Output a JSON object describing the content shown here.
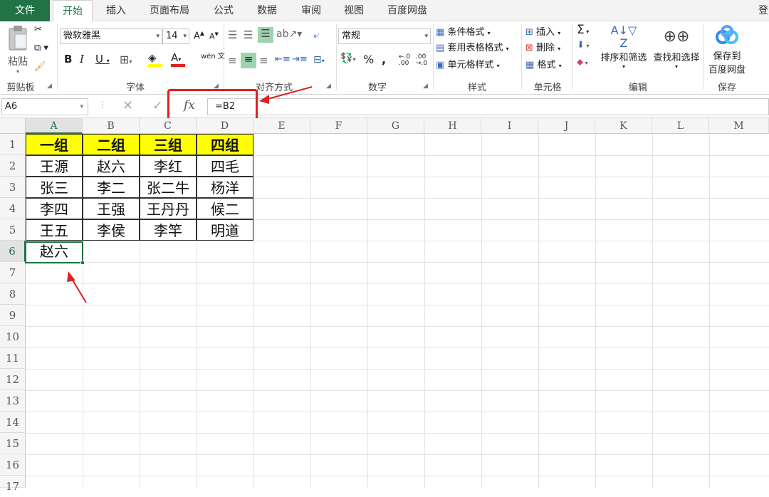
{
  "tabs": [
    "文件",
    "开始",
    "插入",
    "页面布局",
    "公式",
    "数据",
    "审阅",
    "视图",
    "百度网盘"
  ],
  "tabs_right_text": "登",
  "clipboard": {
    "paste": "粘贴",
    "label": "剪贴板"
  },
  "font": {
    "name": "微软雅黑",
    "size": "14",
    "label": "字体",
    "bold": "B",
    "italic": "I",
    "underline": "U",
    "grow": "A",
    "shrink": "A",
    "color_a": "A",
    "phonetic": "wén 文"
  },
  "alignment": {
    "label": "对齐方式"
  },
  "number": {
    "format": "常规",
    "label": "数字",
    "percent": "%",
    "comma": ","
  },
  "styles": {
    "cond": "条件格式",
    "table": "套用表格格式",
    "cell": "单元格样式",
    "label": "样式"
  },
  "cells": {
    "insert": "插入",
    "delete": "删除",
    "format": "格式",
    "label": "单元格"
  },
  "editing": {
    "sigma": "Σ",
    "sort": "排序和筛选",
    "find": "查找和选择",
    "label": "编辑"
  },
  "save": {
    "line1": "保存到",
    "line2": "百度网盘",
    "label": "保存"
  },
  "formula_bar": {
    "namebox": "A6",
    "fx": "fx",
    "formula": "=B2"
  },
  "columns": [
    "A",
    "B",
    "C",
    "D",
    "E",
    "F",
    "G",
    "H",
    "I",
    "J",
    "K",
    "L",
    "M"
  ],
  "rows": [
    "1",
    "2",
    "3",
    "4",
    "5",
    "6",
    "7",
    "8",
    "9",
    "10",
    "11",
    "12",
    "13",
    "14",
    "15",
    "16",
    "17"
  ],
  "sheet": {
    "r1": [
      "一组",
      "二组",
      "三组",
      "四组"
    ],
    "r2": [
      "王源",
      "赵六",
      "李红",
      "四毛"
    ],
    "r3": [
      "张三",
      "李二",
      "张二牛",
      "杨洋"
    ],
    "r4": [
      "李四",
      "王强",
      "王丹丹",
      "候二"
    ],
    "r5": [
      "王五",
      "李侯",
      "李竿",
      "明道"
    ],
    "r6": [
      "赵六"
    ]
  },
  "colors": {
    "accent": "#217346",
    "header_fill": "#ffff00",
    "annotation": "#e02020"
  }
}
